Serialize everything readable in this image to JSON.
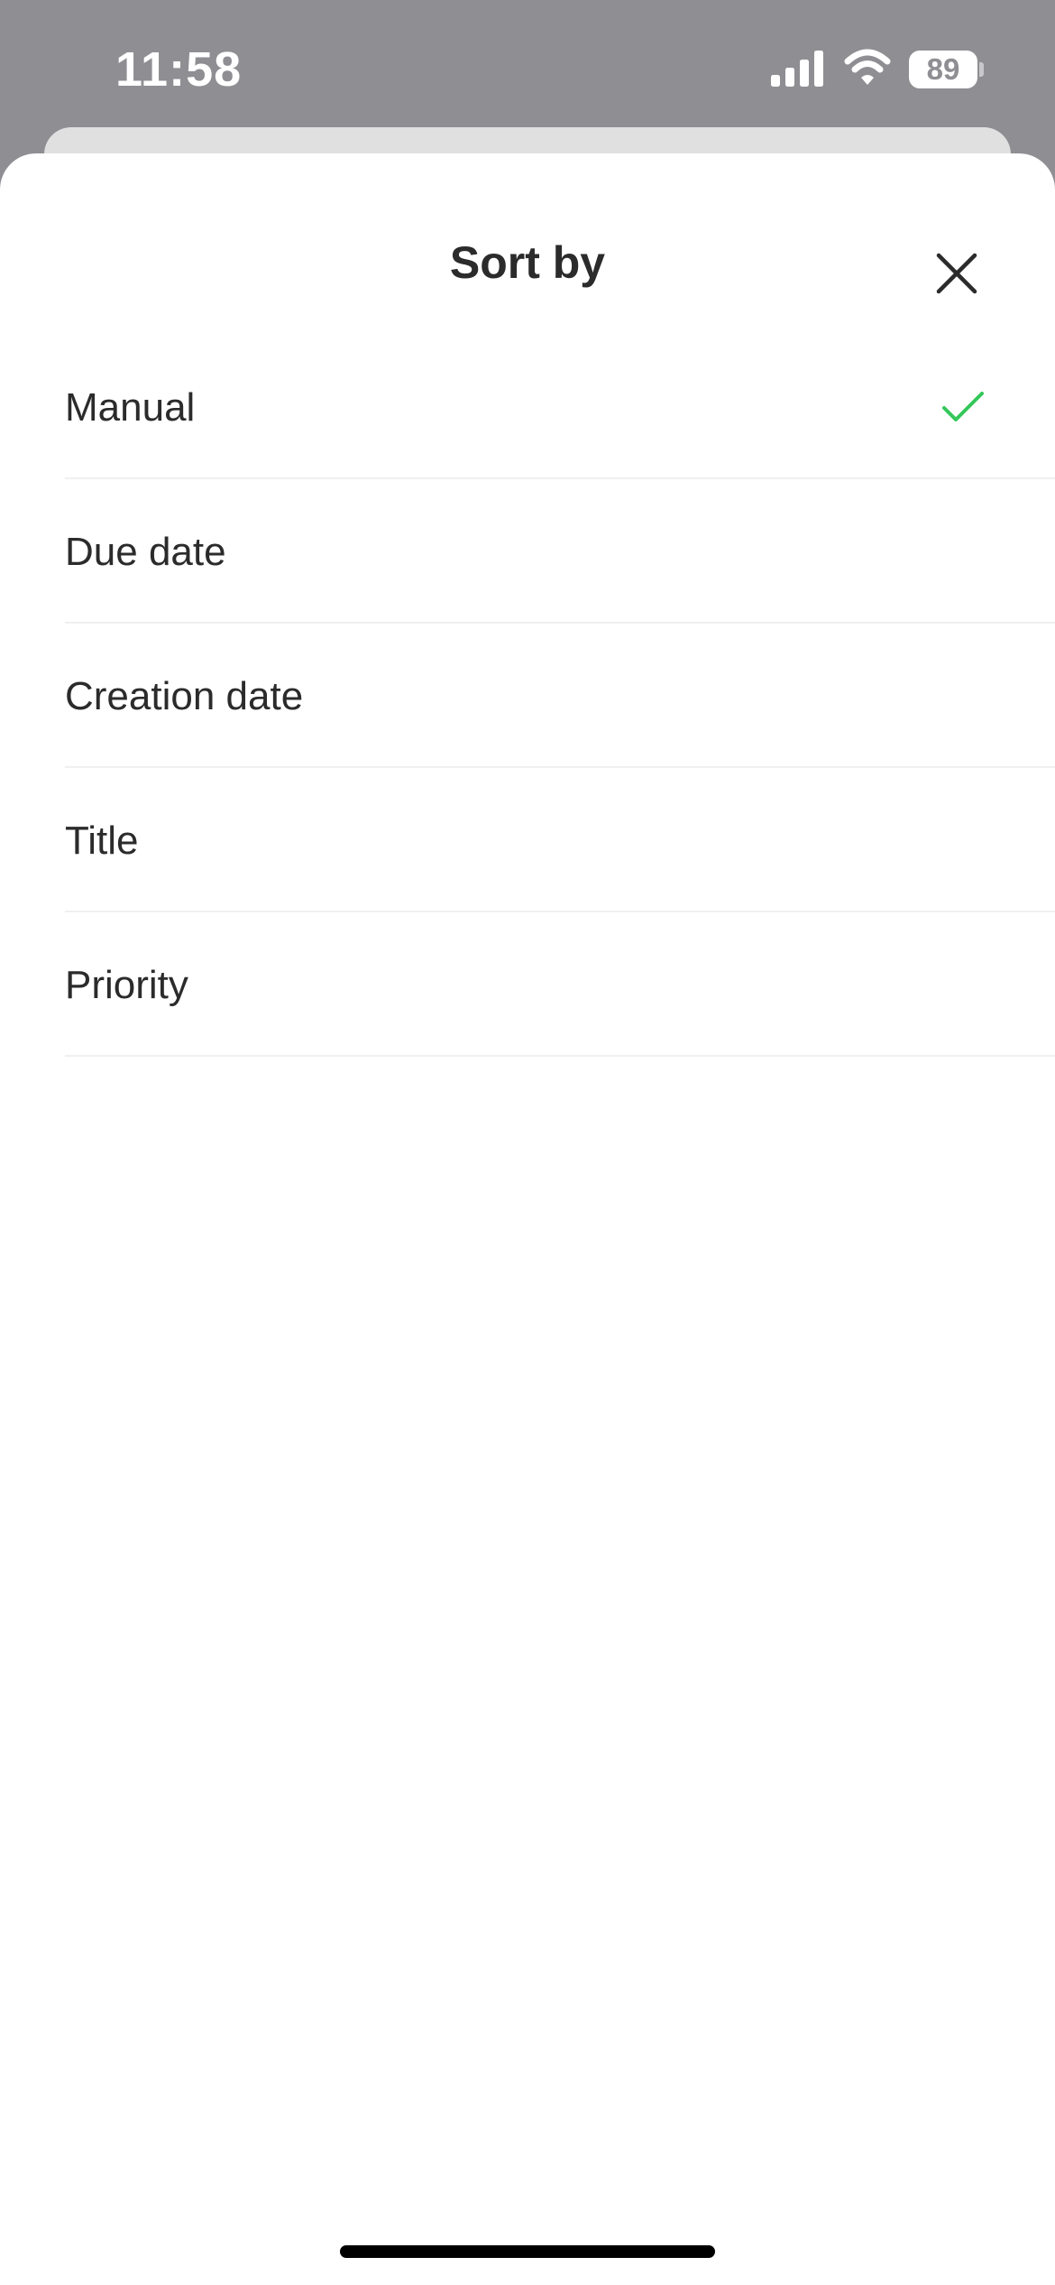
{
  "status_bar": {
    "time": "11:58",
    "battery_level": "89",
    "icons": [
      "signal-icon",
      "wifi-icon",
      "battery-icon"
    ]
  },
  "sheet": {
    "title": "Sort by",
    "close_icon": "close-icon"
  },
  "sort_options": [
    {
      "label": "Manual",
      "selected": true
    },
    {
      "label": "Due date",
      "selected": false
    },
    {
      "label": "Creation date",
      "selected": false
    },
    {
      "label": "Title",
      "selected": false
    },
    {
      "label": "Priority",
      "selected": false
    }
  ],
  "colors": {
    "overlay": "#8e8e93",
    "sheet_background": "#ffffff",
    "text": "#2b2b2b",
    "accent_check": "#34c759",
    "divider": "#f0f0f2"
  }
}
